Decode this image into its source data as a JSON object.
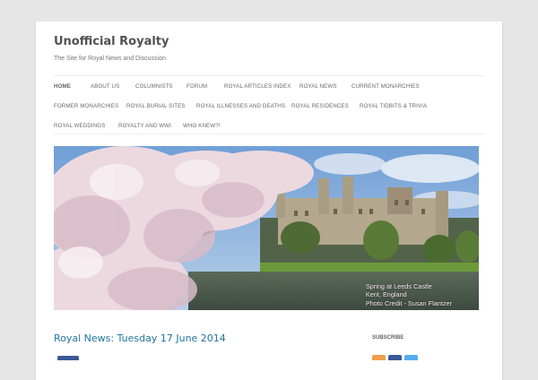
{
  "site": {
    "title": "Unofficial Royalty",
    "description": "The Site for Royal News and Discussion"
  },
  "nav": {
    "items": [
      {
        "label": "Home",
        "active": true
      },
      {
        "label": "About Us"
      },
      {
        "label": "Columnists"
      },
      {
        "label": "Forum"
      },
      {
        "label": "Royal Articles Index"
      },
      {
        "label": "Royal News"
      },
      {
        "label": "Current Monarchies"
      },
      {
        "label": "Former Monarchies"
      },
      {
        "label": "Royal Burial Sites"
      },
      {
        "label": "Royal Illnesses and Deaths"
      },
      {
        "label": "Royal Residences"
      },
      {
        "label": "Royal Tidbits & Trivia"
      },
      {
        "label": "Royal Weddings"
      },
      {
        "label": "Royalty and WWI"
      },
      {
        "label": "Who Knew?!"
      }
    ]
  },
  "banner": {
    "caption_line1": "Spring at Leeds Castle",
    "caption_line2": "Kent, England",
    "caption_line3": "Photo Credit - Susan Flantzer"
  },
  "main": {
    "post_title": "Royal News: Tuesday 17 June 2014"
  },
  "sidebar": {
    "subscribe_title": "Subscribe",
    "subscribe_icons": [
      "rss-icon",
      "facebook-icon",
      "twitter-icon"
    ]
  },
  "colors": {
    "link": "#21759b",
    "background": "#e6e6e6",
    "page": "#ffffff"
  }
}
